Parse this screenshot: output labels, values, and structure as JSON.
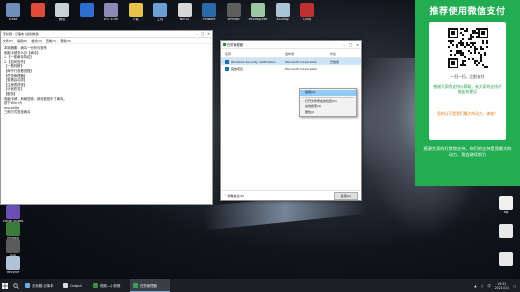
{
  "desktop_top_icons": [
    {
      "label": "a.exe",
      "color": "#6f8fb8"
    },
    {
      "label": "",
      "color": "#e24a3a"
    },
    {
      "label": "微信",
      "color": "#c8d0d8"
    },
    {
      "label": "",
      "color": "#2d6fd1"
    },
    {
      "label": "cn7.4.rar",
      "color": "#8b8bb6"
    },
    {
      "label": "下载",
      "color": "#e6c34a"
    },
    {
      "label": "工具",
      "color": "#6c9fd6"
    },
    {
      "label": "win10",
      "color": "#d7d7d7"
    },
    {
      "label": "VMware",
      "color": "#2a6aa8"
    },
    {
      "label": "vmmap",
      "color": "#5e5e5e"
    },
    {
      "label": "x64dbg.exe",
      "color": "#9bc7a2"
    },
    {
      "label": "x32dbg",
      "color": "#a8c4d6"
    },
    {
      "label": "Cyng",
      "color": "#c03030"
    }
  ],
  "desktop_right_icons": [
    {
      "label": "zip",
      "color": "#e8b84a"
    },
    {
      "label": "新建文本",
      "color": "#dfe7ef"
    },
    {
      "label": "log",
      "color": "#f0f0f0"
    },
    {
      "label": "",
      "color": "#e8e8e8"
    },
    {
      "label": "",
      "color": "#e8e8e8"
    }
  ],
  "desktop_left_icons": [
    {
      "label": "Visual Studio",
      "color": "#6a4fb3"
    },
    {
      "label": "ffmpeg",
      "color": "#3a7d3a"
    },
    {
      "label": "IDA",
      "color": "#5b5b5b"
    },
    {
      "label": "Recycle",
      "color": "#b0c4d8"
    }
  ],
  "notepad": {
    "title": "无标题 - 记事本 [最新精选]",
    "menu": [
      "文件(F)",
      "编辑(E)",
      "格式(O)",
      "查看(V)",
      "帮助(H)"
    ],
    "lines": [
      "本篇摘要：病毒一分析与查杀",
      "电脑卡顿怎么办【病毒】",
      "",
      "1.【一般病毒特征】",
      "2.【如何查杀】",
      "     【一般判断】",
      "     【命令行查看进程】",
      "     【任务管理器】",
      "     【查看启动项】",
      "     【注册表排查】",
      "     【计划任务】",
      "     【服务】",
      "",
      "电脑卡顿，风扇狂转，就可能是中了病毒。",
      "",
      "按下Win+R",
      "msconfig",
      "",
      "三种方式查找病毒"
    ]
  },
  "task_manager": {
    "title": "任务管理器",
    "columns": [
      "名称",
      "发布者",
      "状态"
    ],
    "rows": [
      {
        "name": "Windows Security notification",
        "publisher": "Microsoft Corporation",
        "status": "已启用",
        "icon_color": "#2a6aa8",
        "selected": true
      },
      {
        "name": "其他项目",
        "publisher": "Microsoft Corporation",
        "status": "",
        "icon_color": "#1f6fb5",
        "selected": false
      }
    ],
    "footer_more": "简略信息(D)",
    "end_button": "禁用(A)"
  },
  "context_menu": {
    "items": [
      "禁用(A)",
      "打开文件所在的位置(O)",
      "在线搜索(S)",
      "属性(I)"
    ],
    "highlight_index": 0
  },
  "promo": {
    "header": "推荐使用微信支付",
    "scan_caption": "一扫一扫，立即支付",
    "green_text": "感谢大家的支持与帮助，有大家的支持才能走的更远",
    "orange_text": "您的认可是我们最大的动力，谢谢！",
    "footer": "感谢大家的打赏和支持，你们的支持是我最大的动力，我会继续努力"
  },
  "taskbar": {
    "apps": [
      {
        "label": "无标题-记事本",
        "color": "#6ab0e8",
        "active": false
      },
      {
        "label": "Output",
        "color": "#d9d9d9",
        "active": false
      },
      {
        "label": "视频—小剪辑",
        "color": "#3f8a4c",
        "active": false
      },
      {
        "label": "任务管理器",
        "color": "#3aa05a",
        "active": true
      }
    ],
    "tray_lang": "中",
    "time": "19:51",
    "date": "2021/1/1"
  }
}
